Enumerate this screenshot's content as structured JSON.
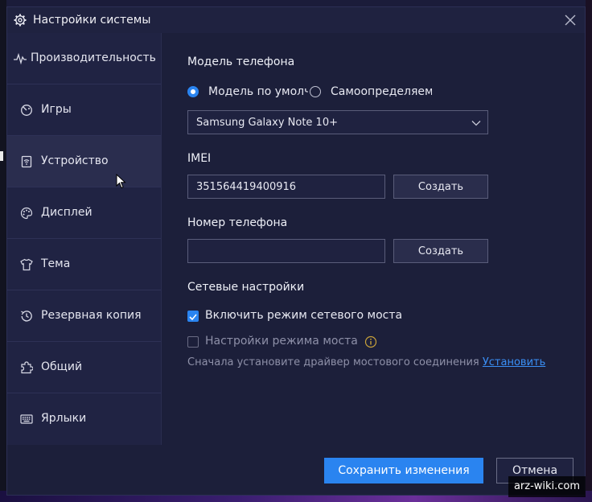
{
  "window": {
    "title": "Настройки системы"
  },
  "sidebar": {
    "items": [
      {
        "label": "Производительность",
        "icon": "pulse-icon"
      },
      {
        "label": "Игры",
        "icon": "gamepad-icon"
      },
      {
        "label": "Устройство",
        "icon": "device-icon",
        "active": true
      },
      {
        "label": "Дисплей",
        "icon": "palette-icon"
      },
      {
        "label": "Тема",
        "icon": "shirt-icon"
      },
      {
        "label": "Резервная копия",
        "icon": "history-icon"
      },
      {
        "label": "Общий",
        "icon": "puzzle-icon"
      },
      {
        "label": "Ярлыки",
        "icon": "keyboard-icon"
      }
    ]
  },
  "phone_model": {
    "heading": "Модель телефона",
    "radio_default": "Модель по умолч",
    "radio_custom": "Самоопределяемі",
    "selected": "default",
    "dropdown_value": "Samsung Galaxy Note 10+"
  },
  "imei": {
    "heading": "IMEI",
    "value": "351564419400916",
    "button": "Создать"
  },
  "phone_number": {
    "heading": "Номер телефона",
    "value": "",
    "button": "Создать"
  },
  "network": {
    "heading": "Сетевые настройки",
    "bridge_mode_label": "Включить режим сетевого моста",
    "bridge_mode_checked": true,
    "bridge_settings_label": "Настройки режима моста",
    "bridge_settings_checked": false,
    "hint_text": "Сначала установите драйвер мостового соединения",
    "install_link": "Установить"
  },
  "footer": {
    "save": "Сохранить изменения",
    "cancel": "Отмена"
  },
  "watermark": "arz-wiki.com",
  "colors": {
    "accent": "#2a84f0",
    "link": "#3a8ff5",
    "window_bg": "#1c1f3a",
    "sidebar_bg": "#202343"
  }
}
